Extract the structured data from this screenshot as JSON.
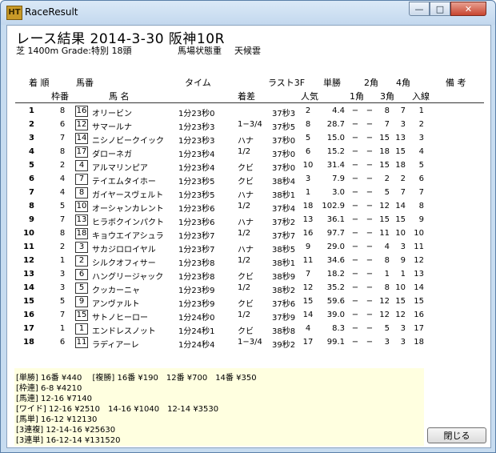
{
  "window": {
    "title": "RaceResult",
    "icon_text": "HT",
    "min": "—",
    "max": "□",
    "close": "✕"
  },
  "header": {
    "race": "レース結果 2014-3-30 阪神10R",
    "info": "芝 1400m Grade:特別 18頭",
    "condition": "馬場状態重",
    "weather": "天候雲"
  },
  "columns": {
    "r1": [
      "着 順",
      "馬番",
      "タイム",
      "ラスト3F",
      "単勝",
      "2角",
      "4角",
      "備 考"
    ],
    "r2": [
      "枠番",
      "馬 名",
      "着差",
      "人気",
      "1角",
      "3角",
      "入線"
    ]
  },
  "rows": [
    {
      "rank": "1",
      "waku": "8",
      "num": "16",
      "name": "オリービン",
      "time": "1分23秒0",
      "margin": "",
      "last3f": "37秒3",
      "pop": "2",
      "odds": "4.4",
      "c1": "−",
      "c2": "−",
      "c3": "8",
      "c4": "7",
      "fin": "1"
    },
    {
      "rank": "2",
      "waku": "6",
      "num": "12",
      "name": "サマールナ",
      "time": "1分23秒3",
      "margin": "1−3/4",
      "last3f": "37秒5",
      "pop": "8",
      "odds": "28.7",
      "c1": "−",
      "c2": "−",
      "c3": "7",
      "c4": "3",
      "fin": "2"
    },
    {
      "rank": "3",
      "waku": "7",
      "num": "14",
      "name": "ニシノビークイック",
      "time": "1分23秒3",
      "margin": "ハナ",
      "last3f": "37秒0",
      "pop": "5",
      "odds": "15.0",
      "c1": "−",
      "c2": "−",
      "c3": "15",
      "c4": "13",
      "fin": "3"
    },
    {
      "rank": "4",
      "waku": "8",
      "num": "17",
      "name": "ダローネガ",
      "time": "1分23秒4",
      "margin": "1/2",
      "last3f": "37秒0",
      "pop": "6",
      "odds": "15.2",
      "c1": "−",
      "c2": "−",
      "c3": "18",
      "c4": "15",
      "fin": "4"
    },
    {
      "rank": "5",
      "waku": "2",
      "num": "4",
      "name": "アルマリンピア",
      "time": "1分23秒4",
      "margin": "クビ",
      "last3f": "37秒0",
      "pop": "10",
      "odds": "31.4",
      "c1": "−",
      "c2": "−",
      "c3": "15",
      "c4": "18",
      "fin": "5"
    },
    {
      "rank": "6",
      "waku": "4",
      "num": "7",
      "name": "テイエムタイホー",
      "time": "1分23秒5",
      "margin": "クビ",
      "last3f": "38秒4",
      "pop": "3",
      "odds": "7.9",
      "c1": "−",
      "c2": "−",
      "c3": "2",
      "c4": "2",
      "fin": "6"
    },
    {
      "rank": "7",
      "waku": "4",
      "num": "8",
      "name": "ガイヤースヴェルト",
      "time": "1分23秒5",
      "margin": "ハナ",
      "last3f": "38秒1",
      "pop": "1",
      "odds": "3.0",
      "c1": "−",
      "c2": "−",
      "c3": "5",
      "c4": "7",
      "fin": "7"
    },
    {
      "rank": "8",
      "waku": "5",
      "num": "10",
      "name": "オーシャンカレント",
      "time": "1分23秒6",
      "margin": "1/2",
      "last3f": "37秒4",
      "pop": "18",
      "odds": "102.9",
      "c1": "−",
      "c2": "−",
      "c3": "12",
      "c4": "14",
      "fin": "8"
    },
    {
      "rank": "9",
      "waku": "7",
      "num": "13",
      "name": "ヒラボクインパクト",
      "time": "1分23秒6",
      "margin": "ハナ",
      "last3f": "37秒2",
      "pop": "13",
      "odds": "36.1",
      "c1": "−",
      "c2": "−",
      "c3": "15",
      "c4": "15",
      "fin": "9"
    },
    {
      "rank": "10",
      "waku": "8",
      "num": "18",
      "name": "キョウエイアシュラ",
      "time": "1分23秒7",
      "margin": "1/2",
      "last3f": "37秒7",
      "pop": "16",
      "odds": "97.7",
      "c1": "−",
      "c2": "−",
      "c3": "11",
      "c4": "10",
      "fin": "10"
    },
    {
      "rank": "11",
      "waku": "2",
      "num": "3",
      "name": "サカジロロイヤル",
      "time": "1分23秒7",
      "margin": "ハナ",
      "last3f": "38秒5",
      "pop": "9",
      "odds": "29.0",
      "c1": "−",
      "c2": "−",
      "c3": "4",
      "c4": "3",
      "fin": "11"
    },
    {
      "rank": "12",
      "waku": "1",
      "num": "2",
      "name": "シルクオフィサー",
      "time": "1分23秒8",
      "margin": "1/2",
      "last3f": "38秒1",
      "pop": "11",
      "odds": "34.6",
      "c1": "−",
      "c2": "−",
      "c3": "8",
      "c4": "9",
      "fin": "12"
    },
    {
      "rank": "13",
      "waku": "3",
      "num": "6",
      "name": "ハングリージャック",
      "time": "1分23秒8",
      "margin": "クビ",
      "last3f": "38秒9",
      "pop": "7",
      "odds": "18.2",
      "c1": "−",
      "c2": "−",
      "c3": "1",
      "c4": "1",
      "fin": "13"
    },
    {
      "rank": "14",
      "waku": "3",
      "num": "5",
      "name": "クッカーニャ",
      "time": "1分23秒9",
      "margin": "1/2",
      "last3f": "38秒2",
      "pop": "12",
      "odds": "35.2",
      "c1": "−",
      "c2": "−",
      "c3": "8",
      "c4": "10",
      "fin": "14"
    },
    {
      "rank": "15",
      "waku": "5",
      "num": "9",
      "name": "アンヴァルト",
      "time": "1分23秒9",
      "margin": "クビ",
      "last3f": "37秒6",
      "pop": "15",
      "odds": "59.6",
      "c1": "−",
      "c2": "−",
      "c3": "12",
      "c4": "15",
      "fin": "15"
    },
    {
      "rank": "16",
      "waku": "7",
      "num": "15",
      "name": "サトノヒーロー",
      "time": "1分24秒0",
      "margin": "1/2",
      "last3f": "37秒9",
      "pop": "14",
      "odds": "39.0",
      "c1": "−",
      "c2": "−",
      "c3": "12",
      "c4": "12",
      "fin": "16"
    },
    {
      "rank": "17",
      "waku": "1",
      "num": "1",
      "name": "エンドレスノット",
      "time": "1分24秒1",
      "margin": "クビ",
      "last3f": "38秒8",
      "pop": "4",
      "odds": "8.3",
      "c1": "−",
      "c2": "−",
      "c3": "5",
      "c4": "3",
      "fin": "17"
    },
    {
      "rank": "18",
      "waku": "6",
      "num": "11",
      "name": "ラディアーレ",
      "time": "1分24秒4",
      "margin": "1−3/4",
      "last3f": "39秒2",
      "pop": "17",
      "odds": "99.1",
      "c1": "−",
      "c2": "−",
      "c3": "3",
      "c4": "3",
      "fin": "18"
    }
  ],
  "payouts": [
    "[単勝] 16番 ¥440　 [複勝] 16番 ¥190　12番 ¥700　14番 ¥350",
    "[枠連] 6-8 ¥4210",
    "[馬連] 12-16 ¥7140",
    "[ワイド] 12-16 ¥2510　14-16 ¥1040　12-14 ¥3530",
    "[馬単] 16-12 ¥12130",
    "[3連複] 12-14-16 ¥25630",
    "[3連単] 16-12-14 ¥131520"
  ],
  "close_button": "閉じる"
}
